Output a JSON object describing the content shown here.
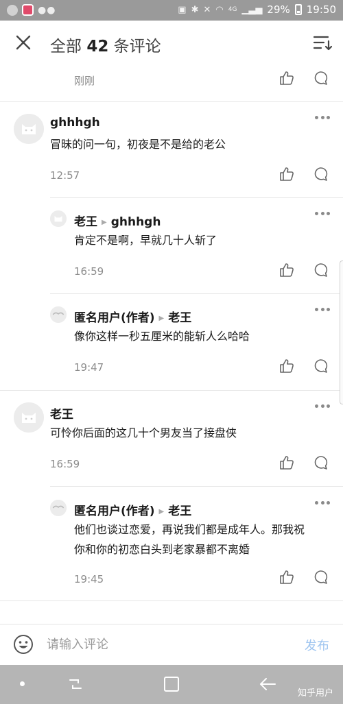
{
  "status_bar": {
    "battery": "29%",
    "time": "19:50",
    "network": "4G"
  },
  "header": {
    "prefix": "全部",
    "count": "42",
    "suffix": "条评论"
  },
  "comments": [
    {
      "time": "刚刚"
    },
    {
      "author": "ghhhgh",
      "content": "冒昧的问一句，初夜是不是给的老公",
      "time": "12:57"
    },
    {
      "author": "老王",
      "reply_to": "ghhhgh",
      "content": "肯定不是啊，早就几十人斩了",
      "time": "16:59"
    },
    {
      "author": "匿名用户(作者)",
      "reply_to": "老王",
      "content": "像你这样一秒五厘米的能斩人么哈哈",
      "time": "19:47"
    },
    {
      "author": "老王",
      "content": "可怜你后面的这几十个男友当了接盘侠",
      "time": "16:59"
    },
    {
      "author": "匿名用户(作者)",
      "reply_to": "老王",
      "content_line1": "他们也谈过恋爱，再说我们都是成年人。那我祝",
      "content_line2": "你和你的初恋白头到老家暴都不离婚",
      "time": "19:45"
    }
  ],
  "input": {
    "placeholder": "请输入评论",
    "send_label": "发布"
  },
  "watermark": "知乎用户",
  "icons": {
    "close": "close-icon",
    "sort": "sort-icon",
    "like": "thumbs-up-icon",
    "reply": "comment-bubble-icon",
    "more": "more-dots-icon",
    "emoji": "emoji-icon"
  },
  "colors": {
    "send_disabled": "#9fc5f0",
    "nav_bar": "#b5b5b5",
    "status_bar": "#9a9a9a"
  }
}
